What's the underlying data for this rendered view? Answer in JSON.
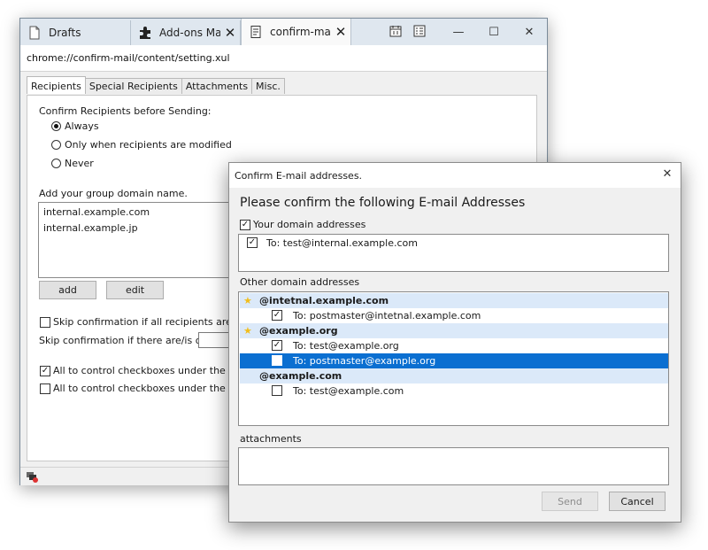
{
  "browser": {
    "tabs": [
      {
        "label": "Drafts",
        "icon": "document-icon"
      },
      {
        "label": "Add-ons Mana",
        "icon": "puzzle-piece-icon"
      },
      {
        "label": "confirm-mail s",
        "icon": "document-icon"
      }
    ],
    "close_glyph": "✕",
    "toolbar_icons": [
      "calendar-icon",
      "tasks-icon"
    ],
    "caption": {
      "minimize": "—",
      "maximize": "☐",
      "close": "✕"
    },
    "url": "chrome://confirm-mail/content/setting.xul"
  },
  "settings": {
    "tabs": [
      "Recipients",
      "Special Recipients",
      "Attachments",
      "Misc."
    ],
    "confirm_heading": "Confirm Recipients before Sending:",
    "radio_options": [
      {
        "label": "Always",
        "selected": true
      },
      {
        "label": "Only when recipients are modified",
        "selected": false
      },
      {
        "label": "Never",
        "selected": false
      }
    ],
    "domain_heading": "Add your group domain name.",
    "domains": [
      "internal.example.com",
      "internal.example.jp"
    ],
    "add_label": "add",
    "edit_label": "edit",
    "skip_all_label": "Skip confirmation if all recipients are your",
    "skip_all_checked": false,
    "skip_count_label": "Skip confirmation if there are/is only",
    "skip_count_value": "",
    "control_your_label": "All to control checkboxes under the \"Your",
    "control_your_checked": true,
    "control_other_label": "All to control checkboxes under the \"Othe",
    "control_other_checked": false
  },
  "dialog": {
    "title": "Confirm E-mail addresses.",
    "close_glyph": "✕",
    "heading": "Please confirm the following E-mail Addresses",
    "your_domain_label": "Your domain addresses",
    "your_domain_checked": true,
    "your_items": [
      {
        "text": "To: test@internal.example.com",
        "checked": true
      }
    ],
    "other_label": "Other domain addresses",
    "groups": [
      {
        "domain": "@intetnal.example.com",
        "starred": true,
        "items": [
          {
            "text": "To: postmaster@intetnal.example.com",
            "checked": true,
            "selected": false
          }
        ]
      },
      {
        "domain": "@example.org",
        "starred": true,
        "items": [
          {
            "text": "To: test@example.org",
            "checked": true,
            "selected": false
          },
          {
            "text": "To: postmaster@example.org",
            "checked": true,
            "selected": true
          }
        ]
      },
      {
        "domain": "@example.com",
        "starred": false,
        "items": [
          {
            "text": "To: test@example.com",
            "checked": false,
            "selected": false
          }
        ]
      }
    ],
    "attachments_label": "attachments",
    "send_label": "Send",
    "cancel_label": "Cancel",
    "colors": {
      "selection": "#0b6fd1",
      "group_row": "#dbe9f9",
      "star": "#f1bd1b"
    }
  }
}
